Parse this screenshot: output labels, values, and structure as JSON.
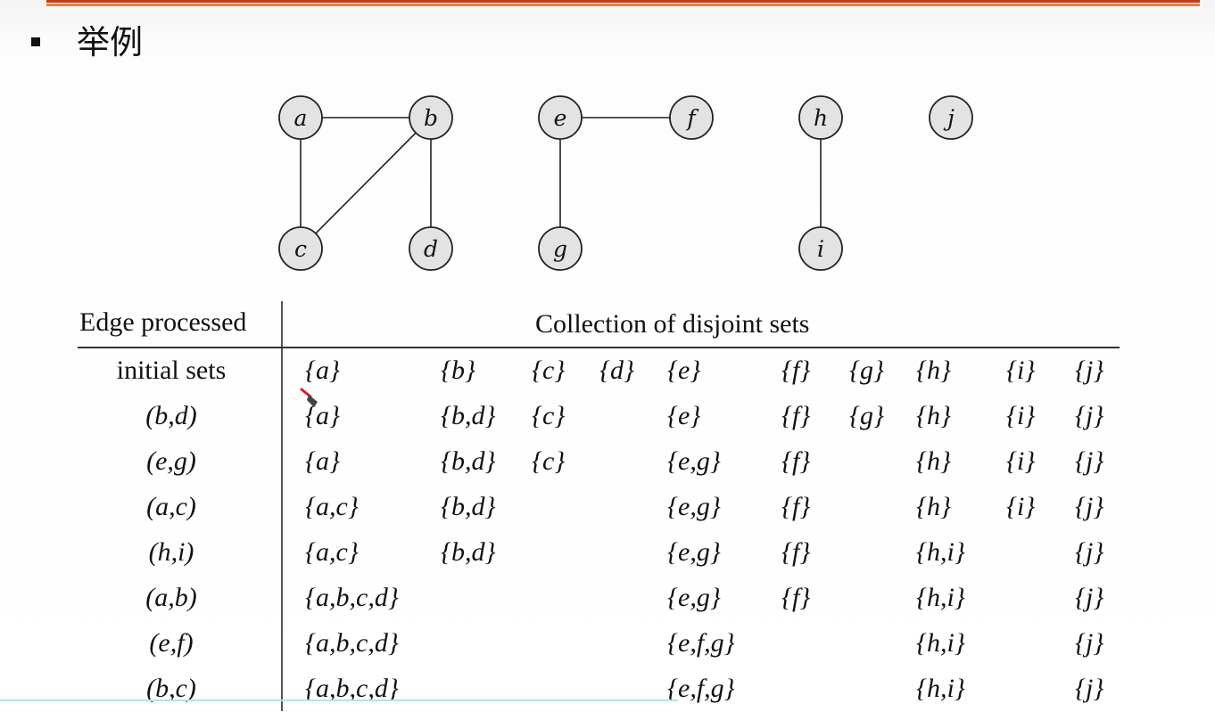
{
  "slide": {
    "heading": "举例"
  },
  "graph": {
    "nodes": [
      "a",
      "b",
      "c",
      "d",
      "e",
      "f",
      "g",
      "h",
      "i",
      "j"
    ],
    "edges": [
      [
        "a",
        "b"
      ],
      [
        "a",
        "c"
      ],
      [
        "b",
        "c"
      ],
      [
        "b",
        "d"
      ],
      [
        "e",
        "f"
      ],
      [
        "e",
        "g"
      ],
      [
        "h",
        "i"
      ]
    ]
  },
  "table": {
    "header_edge": "Edge processed",
    "header_sets": "Collection of disjoint sets",
    "rows": [
      {
        "edge": "initial sets",
        "sets": [
          "{a}",
          "{b}",
          "{c}",
          "{d}",
          "{e}",
          "{f}",
          "{g}",
          "{h}",
          "{i}",
          "{j}"
        ]
      },
      {
        "edge": "(b,d)",
        "sets": [
          "{a}",
          "{b,d}",
          "{c}",
          "",
          "{e}",
          "{f}",
          "{g}",
          "{h}",
          "{i}",
          "{j}"
        ]
      },
      {
        "edge": "(e,g)",
        "sets": [
          "{a}",
          "{b,d}",
          "{c}",
          "",
          "{e,g}",
          "{f}",
          "",
          "{h}",
          "{i}",
          "{j}"
        ]
      },
      {
        "edge": "(a,c)",
        "sets": [
          "{a,c}",
          "{b,d}",
          "",
          "",
          "{e,g}",
          "{f}",
          "",
          "{h}",
          "{i}",
          "{j}"
        ]
      },
      {
        "edge": "(h,i)",
        "sets": [
          "{a,c}",
          "{b,d}",
          "",
          "",
          "{e,g}",
          "{f}",
          "",
          "{h,i}",
          "",
          "{j}"
        ]
      },
      {
        "edge": "(a,b)",
        "sets": [
          "{a,b,c,d}",
          "",
          "",
          "",
          "{e,g}",
          "{f}",
          "",
          "{h,i}",
          "",
          "{j}"
        ]
      },
      {
        "edge": "(e,f)",
        "sets": [
          "{a,b,c,d}",
          "",
          "",
          "",
          "{e,f,g}",
          "",
          "",
          "{h,i}",
          "",
          "{j}"
        ]
      },
      {
        "edge": "(b,c)",
        "sets": [
          "{a,b,c,d}",
          "",
          "",
          "",
          "{e,f,g}",
          "",
          "",
          "{h,i}",
          "",
          "{j}"
        ]
      }
    ]
  },
  "colors": {
    "accent_dark": "#c23a1c",
    "accent_light": "#e8823b",
    "node_fill": "#e3e3e3"
  },
  "icons": {
    "cursor": "pen-cursor-icon"
  }
}
